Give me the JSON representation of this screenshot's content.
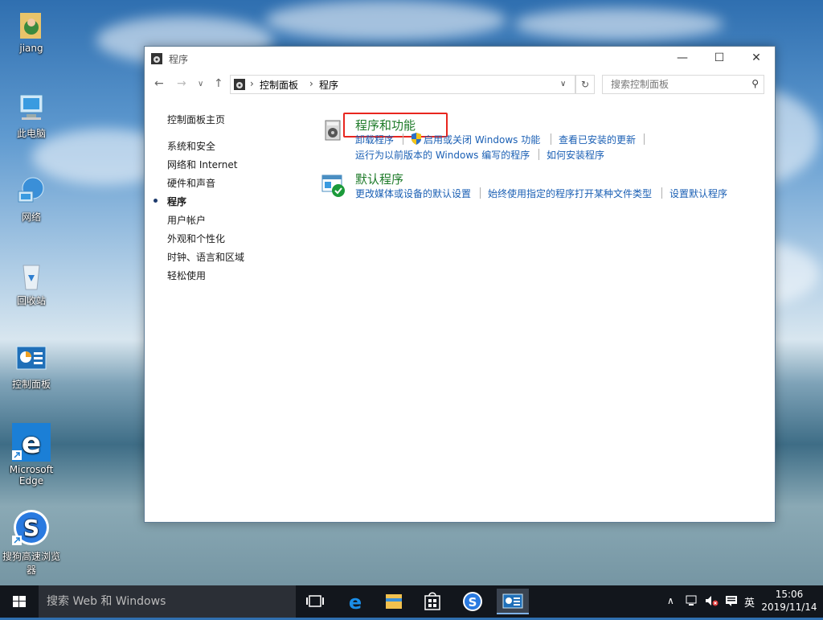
{
  "desktop": {
    "icons": [
      {
        "label": "jiang"
      },
      {
        "label": "此电脑"
      },
      {
        "label": "网络"
      },
      {
        "label": "回收站"
      },
      {
        "label": "控制面板"
      },
      {
        "label": "Microsoft Edge"
      },
      {
        "label": "搜狗高速浏览器"
      }
    ]
  },
  "window": {
    "title": "程序",
    "breadcrumb": [
      "控制面板",
      "程序"
    ],
    "search_placeholder": "搜索控制面板",
    "sidebar": {
      "home": "控制面板主页",
      "items": [
        "系统和安全",
        "网络和 Internet",
        "硬件和声音",
        "程序",
        "用户帐户",
        "外观和个性化",
        "时钟、语言和区域",
        "轻松使用"
      ],
      "current": "程序"
    },
    "categories": [
      {
        "title": "程序和功能",
        "links": [
          "卸载程序",
          "启用或关闭 Windows 功能",
          "查看已安装的更新",
          "运行为以前版本的 Windows 编写的程序",
          "如何安装程序"
        ]
      },
      {
        "title": "默认程序",
        "links": [
          "更改媒体或设备的默认设置",
          "始终使用指定的程序打开某种文件类型",
          "设置默认程序"
        ]
      }
    ]
  },
  "taskbar": {
    "search_text": "搜索 Web 和 Windows",
    "ime": "英",
    "time": "15:06",
    "date": "2019/11/14"
  },
  "colors": {
    "link": "#1a5fb4",
    "category_title": "#1d7a28",
    "highlight": "#e8261f",
    "taskbar": "#12161c"
  }
}
